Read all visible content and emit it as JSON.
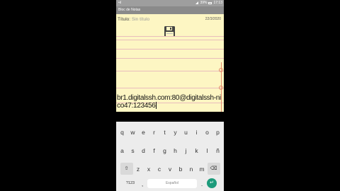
{
  "status_bar": {
    "left": "•ıl",
    "right": "39%",
    "time": "17:13"
  },
  "app_bar": {
    "title": "Bloc de Notas"
  },
  "note": {
    "title_label": "Título:",
    "title_value": "Sin título",
    "date": "22/3/2020",
    "body": "br1.digitalssh.com:80@digitalssh-nico47:123456",
    "save_icon": "floppy-disk-icon"
  },
  "colors": {
    "paper": "#fdf6c3",
    "rule": "#e9bcbc",
    "margin": "#e38a6c",
    "accent": "#1c9a7a"
  },
  "keyboard": {
    "row1": [
      "q",
      "w",
      "e",
      "r",
      "t",
      "y",
      "u",
      "i",
      "o",
      "p"
    ],
    "row2": [
      "a",
      "s",
      "d",
      "f",
      "g",
      "h",
      "j",
      "k",
      "l",
      "ñ"
    ],
    "row3": [
      "z",
      "x",
      "c",
      "v",
      "b",
      "n",
      "m"
    ],
    "shift": "⇧",
    "backspace": "⌫",
    "symbols": "?123",
    "comma": ",",
    "space": "Español",
    "period": ".",
    "enter": "↵"
  }
}
